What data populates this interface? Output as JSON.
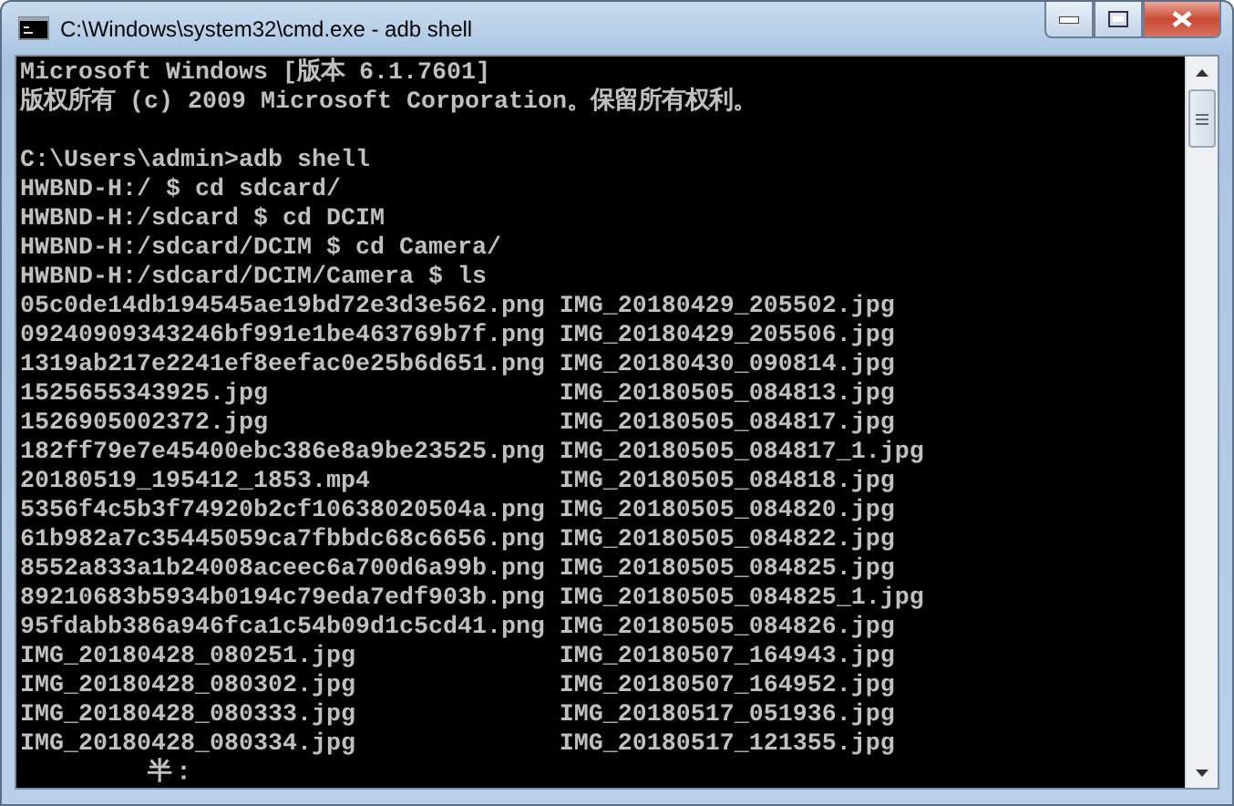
{
  "window": {
    "title": "C:\\Windows\\system32\\cmd.exe - adb  shell"
  },
  "console": {
    "banner": [
      {
        "text": "Microsoft Windows [版本 6.1.7601]"
      },
      {
        "text": "版权所有 (c) 2009 Microsoft Corporation。保留所有权利。"
      }
    ],
    "lines": [
      {
        "text": "C:\\Users\\admin>adb shell"
      },
      {
        "text": "HWBND-H:/ $ cd sdcard/"
      },
      {
        "text": "HWBND-H:/sdcard $ cd DCIM"
      },
      {
        "text": "HWBND-H:/sdcard/DCIM $ cd Camera/"
      },
      {
        "text": "HWBND-H:/sdcard/DCIM/Camera $ ls"
      }
    ],
    "listing": [
      [
        "05c0de14db194545ae19bd72e3d3e562.png",
        "IMG_20180429_205502.jpg"
      ],
      [
        "09240909343246bf991e1be463769b7f.png",
        "IMG_20180429_205506.jpg"
      ],
      [
        "1319ab217e2241ef8eefac0e25b6d651.png",
        "IMG_20180430_090814.jpg"
      ],
      [
        "1525655343925.jpg",
        "IMG_20180505_084813.jpg"
      ],
      [
        "1526905002372.jpg",
        "IMG_20180505_084817.jpg"
      ],
      [
        "182ff79e7e45400ebc386e8a9be23525.png",
        "IMG_20180505_084817_1.jpg"
      ],
      [
        "20180519_195412_1853.mp4",
        "IMG_20180505_084818.jpg"
      ],
      [
        "5356f4c5b3f74920b2cf10638020504a.png",
        "IMG_20180505_084820.jpg"
      ],
      [
        "61b982a7c35445059ca7fbbdc68c6656.png",
        "IMG_20180505_084822.jpg"
      ],
      [
        "8552a833a1b24008aceec6a700d6a99b.png",
        "IMG_20180505_084825.jpg"
      ],
      [
        "89210683b5934b0194c79eda7edf903b.png",
        "IMG_20180505_084825_1.jpg"
      ],
      [
        "95fdabb386a946fca1c54b09d1c5cd41.png",
        "IMG_20180505_084826.jpg"
      ],
      [
        "IMG_20180428_080251.jpg",
        "IMG_20180507_164943.jpg"
      ],
      [
        "IMG_20180428_080302.jpg",
        "IMG_20180507_164952.jpg"
      ],
      [
        "IMG_20180428_080333.jpg",
        "IMG_20180517_051936.jpg"
      ],
      [
        "IMG_20180428_080334.jpg",
        "IMG_20180517_121355.jpg"
      ]
    ],
    "ime_status": "半："
  }
}
